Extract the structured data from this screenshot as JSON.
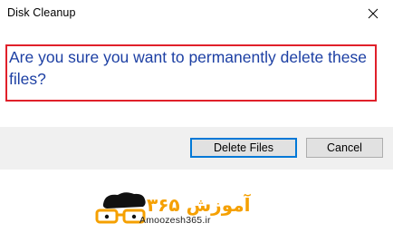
{
  "window": {
    "title": "Disk Cleanup",
    "close_icon": "close-icon"
  },
  "message": {
    "text": "Are you sure you want to permanently delete these files?",
    "highlight_color": "#e0202a",
    "text_color": "#1c3fa3"
  },
  "buttons": {
    "delete_label": "Delete Files",
    "cancel_label": "Cancel",
    "focus_color": "#0078d7"
  },
  "watermark": {
    "logo_text": "Amoozesh365.ir",
    "logo_script": "آموزش ۳۶۵",
    "logo_icon": "glasses-face-logo",
    "logo_color": "#f5a000"
  }
}
